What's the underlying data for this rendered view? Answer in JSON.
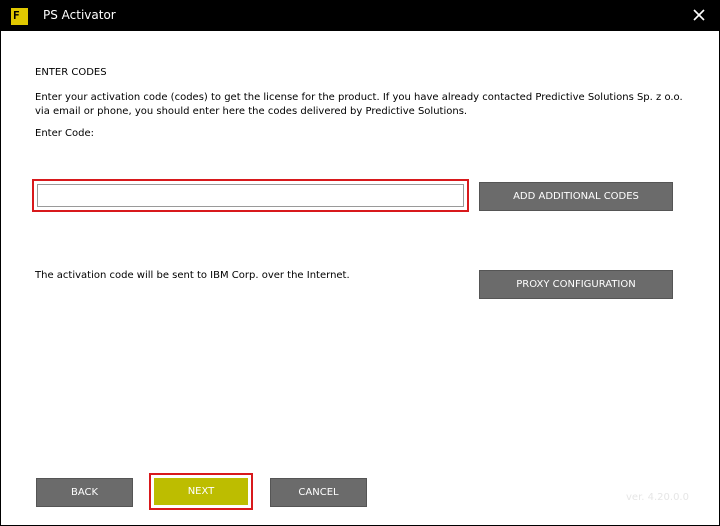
{
  "window": {
    "title": "PS Activator",
    "icon": "ps-activator-app-icon",
    "icon_glyph": "F",
    "close_icon": "close-icon"
  },
  "content": {
    "heading": "ENTER CODES",
    "description": "Enter your activation code (codes) to get the license for the product. If you have already contacted Predictive Solutions Sp. z o.o. via email or phone, you should enter here the codes delivered by Predictive Solutions.",
    "code_label": "Enter Code:",
    "code_input": {
      "value": "",
      "placeholder": ""
    },
    "add_codes_label": "ADD ADDITIONAL CODES",
    "internet_note": "The activation code will be sent to IBM Corp. over the Internet.",
    "proxy_label": "PROXY CONFIGURATION"
  },
  "footer": {
    "back_label": "BACK",
    "next_label": "NEXT",
    "cancel_label": "CANCEL",
    "version": "ver. 4.20.0.0"
  },
  "colors": {
    "titlebar": "#000000",
    "button_gray": "#6b6b6b",
    "next_button": "#bdbd00",
    "highlight_red": "#d8191c"
  }
}
